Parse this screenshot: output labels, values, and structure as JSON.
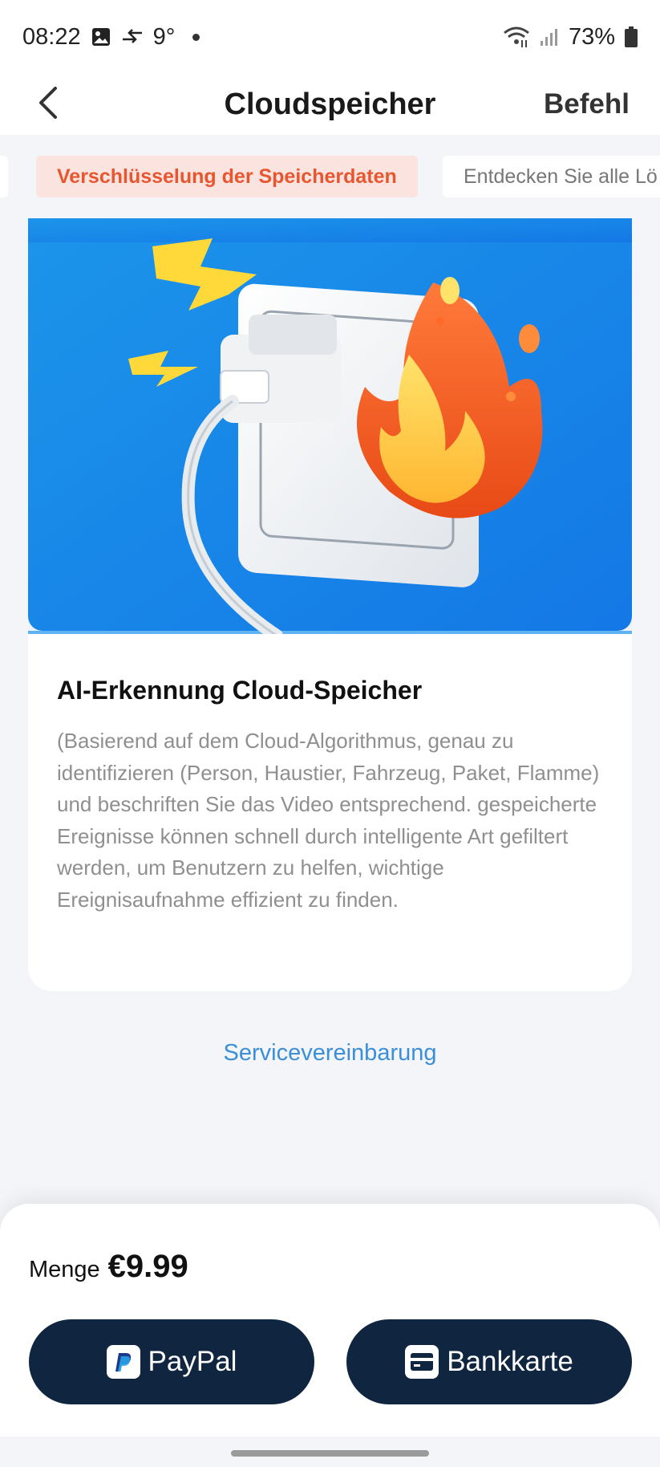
{
  "status_bar": {
    "time": "08:22",
    "temperature": "9°",
    "battery": "73%",
    "icons": [
      "image-icon",
      "data-transfer-icon",
      "wifi-icon",
      "signal-icon",
      "battery-icon"
    ]
  },
  "nav": {
    "title": "Cloudspeicher",
    "action": "Befehl",
    "back_icon": "chevron-left-icon"
  },
  "tabs": [
    {
      "label": "Verschlüsselung der Speicherdaten",
      "active": true
    },
    {
      "label": "Entdecken Sie alle Lö",
      "active": false
    }
  ],
  "feature": {
    "title": "AI-Erkennung Cloud-Speicher",
    "description": "(Basierend auf dem Cloud-Algorithmus, genau zu identifizieren (Person, Haustier, Fahrzeug, Paket, Flamme) und beschriften Sie das Video entsprechend. gespeicherte Ereignisse können schnell durch intelligente Art gefiltert werden, um Benutzern zu helfen, wichtige Ereignisaufnahme effizient zu finden.",
    "illustration": "plug-fire-illustration"
  },
  "service_link": "Servicevereinbarung",
  "purchase": {
    "label": "Menge",
    "price": "€9.99",
    "buttons": [
      {
        "label": "PayPal",
        "icon": "paypal-icon"
      },
      {
        "label": "Bankkarte",
        "icon": "credit-card-icon"
      }
    ]
  },
  "colors": {
    "accent_orange": "#e8562f",
    "tab_active_bg": "#fbe4e0",
    "link_blue": "#3a8fd8",
    "button_navy": "#0f2540",
    "hero_blue": "#1e8fe6"
  }
}
